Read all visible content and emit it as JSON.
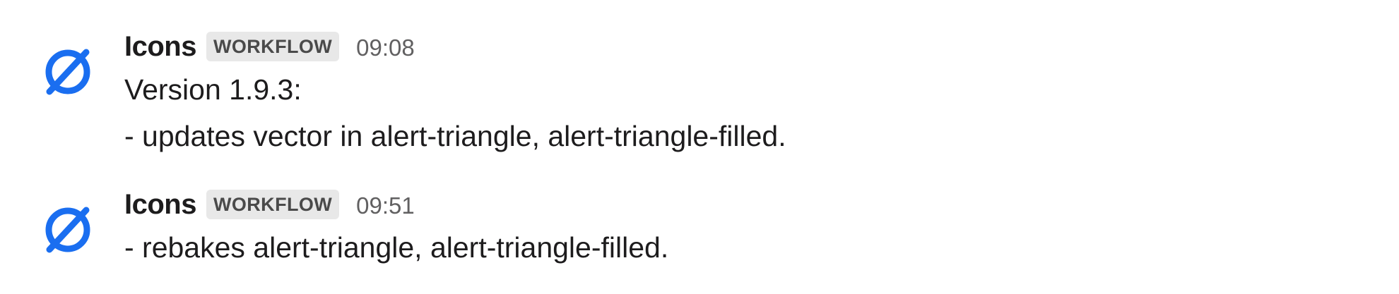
{
  "messages": [
    {
      "sender": "Icons",
      "badge": "WORKFLOW",
      "time": "09:08",
      "avatar_icon": "empty-set-icon",
      "lines": [
        "Version 1.9.3:",
        "- updates vector in alert-triangle, alert-triangle-filled."
      ]
    },
    {
      "sender": "Icons",
      "badge": "WORKFLOW",
      "time": "09:51",
      "avatar_icon": "empty-set-icon",
      "lines": [
        "- rebakes alert-triangle, alert-triangle-filled."
      ]
    }
  ],
  "colors": {
    "avatar_icon": "#1a6ef0",
    "badge_bg": "#e8e8e8",
    "text": "#1d1c1d",
    "timestamp": "#616061"
  }
}
